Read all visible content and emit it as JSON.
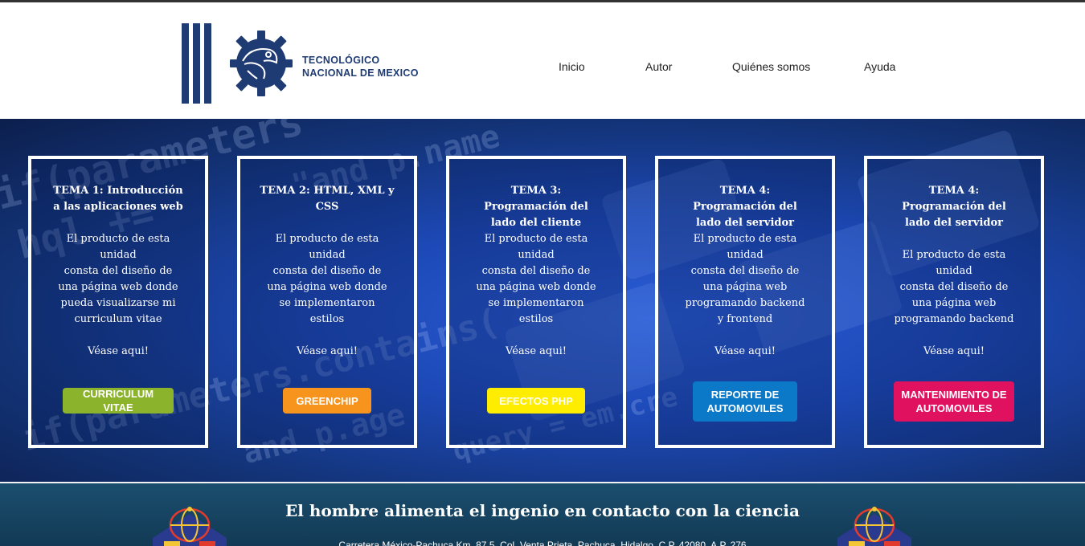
{
  "header": {
    "logo_line1": "TECNOLÓGICO",
    "logo_line2": "NACIONAL DE MEXICO",
    "brand_color": "#1f3b73"
  },
  "nav": {
    "items": [
      {
        "label": "Inicio"
      },
      {
        "label": "Autor"
      },
      {
        "label": "Quiénes somos"
      },
      {
        "label": "Ayuda"
      }
    ]
  },
  "hero": {
    "code_lines": [
      "if(parameters",
      "hql +=",
      "\"and p.name",
      "if(parameters.contains(",
      "and p.age",
      "query = em.cre"
    ]
  },
  "cards": [
    {
      "title": "TEMA 1: Introducción\na las aplicaciones web",
      "desc": "El producto de esta\nunidad\nconsta del diseño de\nuna página web donde\npueda visualizarse mi\ncurriculum vitae",
      "see": "Véase aqui!",
      "button": "CURRICULUM VITAE",
      "button_color": "#8cb32c"
    },
    {
      "title": "TEMA 2: HTML, XML y\nCSS",
      "desc": "El producto de esta\nunidad\nconsta del diseño de\nuna página web donde\nse implementaron\nestilos",
      "see": "Véase aqui!",
      "button": "GREENCHIP",
      "button_color": "#f7941d"
    },
    {
      "title": "TEMA 3:\nProgramación del\nlado del cliente",
      "desc": "El producto de esta\nunidad\nconsta del diseño de\nuna página web donde\nse implementaron\nestilos",
      "see": "Véase aqui!",
      "button": "EFECTOS PHP",
      "button_color": "#ffed00"
    },
    {
      "title": "TEMA 4:\nProgramación del\nlado del servidor",
      "desc": "El producto de esta\nunidad\nconsta del diseño de\nuna página web\nprogramando backend\ny frontend",
      "see": "Véase aqui!",
      "button": "REPORTE DE\nAUTOMOVILES",
      "button_color": "#0b78c8"
    },
    {
      "title": "TEMA 4:\nProgramación del\nlado del servidor",
      "desc": "El producto de esta\nunidad\nconsta del diseño de\nuna página web\nprogramando backend",
      "see": "Véase aqui!",
      "button": "MANTENIMIENTO DE\nAUTOMOVILES",
      "button_color": "#e0115f"
    }
  ],
  "footer": {
    "slogan": "El hombre alimenta el ingenio en contacto con la ciencia",
    "address": "Carretera México-Pachuca Km. 87.5, Col. Venta Prieta, Pachuca, Hidalgo, C.P. 42080, A.P. 276"
  }
}
